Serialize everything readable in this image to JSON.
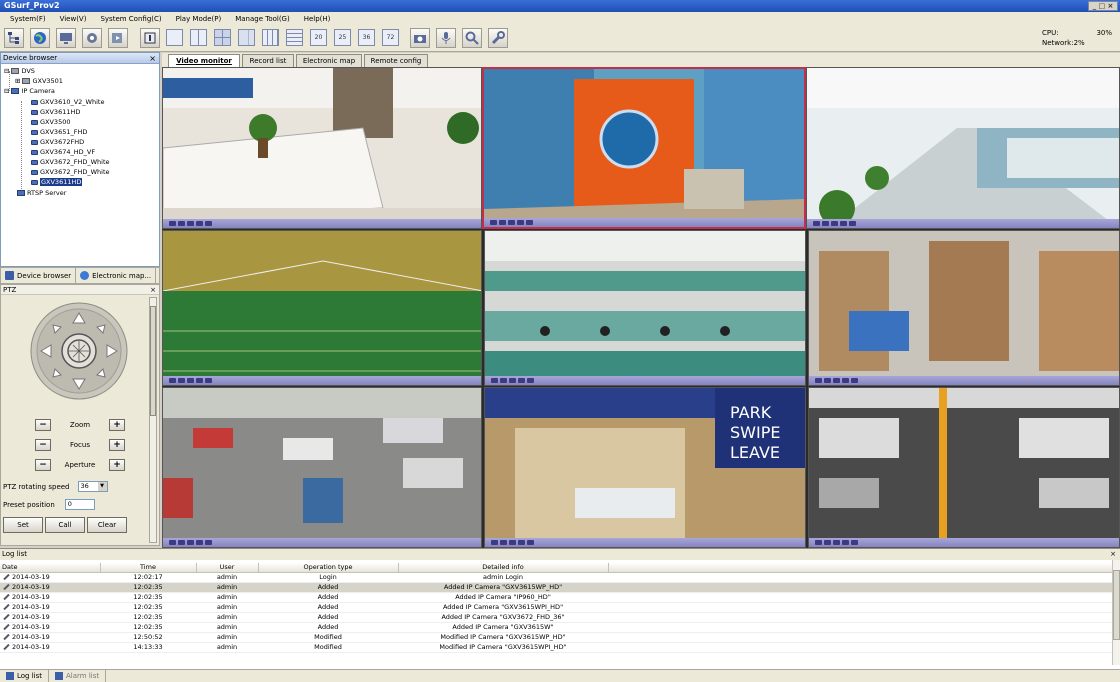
{
  "window": {
    "title": "GSurf_Prov2",
    "controls": "_ □ ×"
  },
  "menu": [
    "System(F)",
    "View(V)",
    "System Config(C)",
    "Play Mode(P)",
    "Manage Tool(G)",
    "Help(H)"
  ],
  "toolbar": {
    "grid_numbers": [
      "20",
      "25",
      "36",
      "72"
    ],
    "cpu_label": "CPU:",
    "cpu_value": "30%",
    "network_label": "Network:",
    "network_value": "2%"
  },
  "device_browser": {
    "title": "Device browser",
    "nodes": {
      "dvs": "DVS",
      "gxv3501": "GXV3501",
      "ip_camera": "IP Camera",
      "cams": [
        "GXV3610_V2_White",
        "GXV3611HD",
        "GXV3500",
        "GXV3651_FHD",
        "GXV3672FHD",
        "GXV3674_HD_VF",
        "GXV3672_FHD_White",
        "GXV3672_FHD_White",
        "GXV3611HD"
      ],
      "rtsp": "RTSP Server"
    }
  },
  "panel_tabs": {
    "device_browser": "Device browser",
    "electronic_map": "Electronic map..."
  },
  "ptz": {
    "title": "PTZ",
    "zoom": "Zoom",
    "focus": "Focus",
    "aperture": "Aperture",
    "minus": "−",
    "plus": "+",
    "speed_label": "PTZ rotating speed",
    "speed_value": "36",
    "preset_label": "Preset position",
    "preset_value": "0",
    "set": "Set",
    "call": "Call",
    "clear": "Clear"
  },
  "video_tabs": [
    "Video monitor",
    "Record list",
    "Electronic map",
    "Remote config"
  ],
  "log": {
    "title": "Log list",
    "columns": [
      "Date",
      "Time",
      "User",
      "Operation type",
      "Detailed info"
    ],
    "rows": [
      [
        "2014-03-19",
        "12:02:17",
        "admin",
        "Login",
        "admin Login"
      ],
      [
        "2014-03-19",
        "12:02:35",
        "admin",
        "Added",
        "Added IP Camera \"GXV3615WP_HD\""
      ],
      [
        "2014-03-19",
        "12:02:35",
        "admin",
        "Added",
        "Added IP Camera \"IP960_HD\""
      ],
      [
        "2014-03-19",
        "12:02:35",
        "admin",
        "Added",
        "Added IP Camera \"GXV3615WPI_HD\""
      ],
      [
        "2014-03-19",
        "12:02:35",
        "admin",
        "Added",
        "Added IP Camera \"GXV3672_FHD_36\""
      ],
      [
        "2014-03-19",
        "12:02:35",
        "admin",
        "Added",
        "Added IP Camera \"GXV3615W\""
      ],
      [
        "2014-03-19",
        "12:50:52",
        "admin",
        "Modified",
        "Modified IP Camera \"GXV3615WP_HD\""
      ],
      [
        "2014-03-19",
        "14:13:33",
        "admin",
        "Modified",
        "Modified IP Camera \"GXV3615WPI_HD\""
      ]
    ],
    "tabs": {
      "log_list": "Log list",
      "alarm_list": "Alarm list"
    }
  },
  "colors": {
    "accent": "#1e3c8c",
    "active_cell": "#c0304a",
    "ctrl_bar": "#8584c0"
  }
}
